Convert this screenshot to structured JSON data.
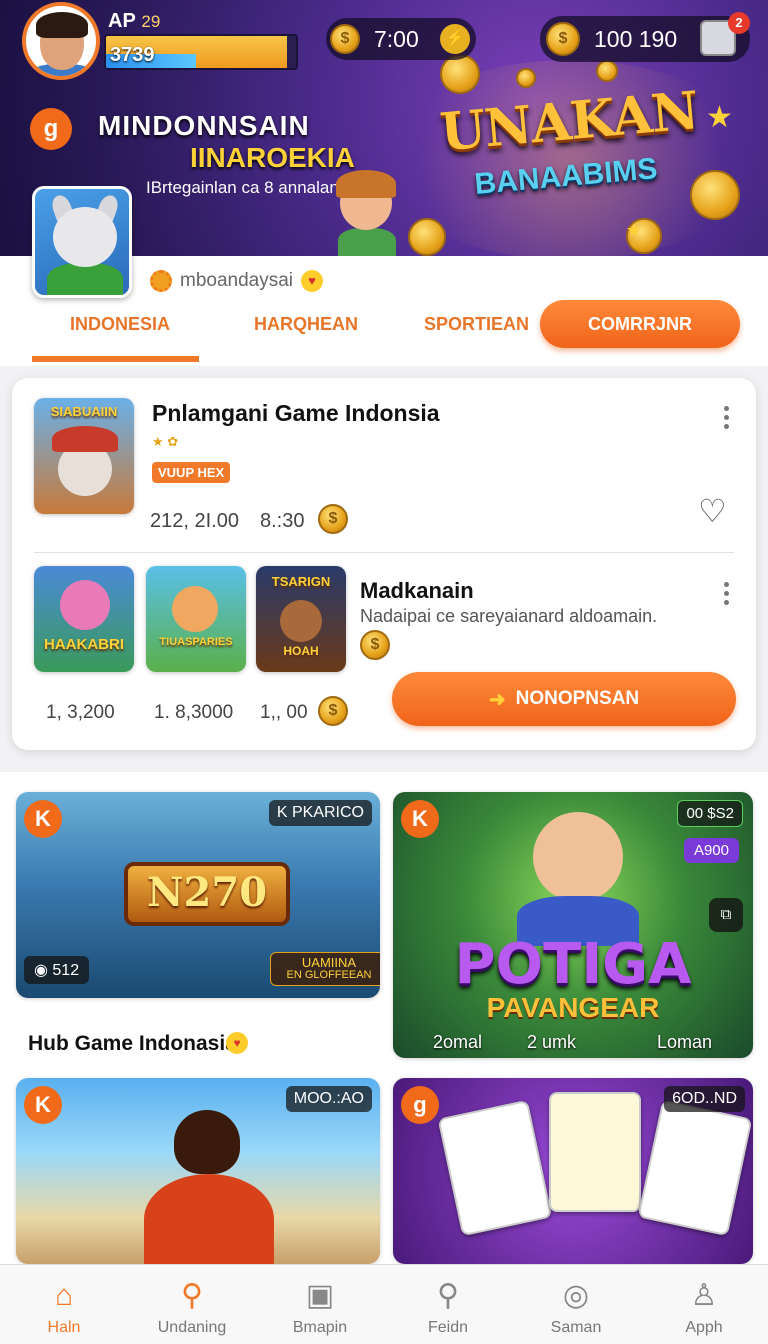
{
  "header": {
    "player_level": "AP",
    "player_level_num": "29",
    "xp_value": "3739",
    "xp_progress": 0.95,
    "timer": "7:00",
    "coin_balance": "100 190",
    "notification_count": "2",
    "brand_logo_letter": "g",
    "brand_title": "MINDONNSAIN",
    "brand_subtitle": "IINAROEKIA",
    "brand_description": "IBrtegainlan ca 8 annalani",
    "promo_title": "UNAKAN",
    "promo_subtitle": "BANAABIMS"
  },
  "profile": {
    "handle": "mboandaysai"
  },
  "tabs": [
    {
      "label": "INDONESIA",
      "active": true
    },
    {
      "label": "HARQHEAN",
      "active": false
    },
    {
      "label": "SPORTIEAN",
      "active": false
    }
  ],
  "community_button": "COMRRJNR",
  "featured": {
    "thumb_label": "SIABUAIIN",
    "title": "Pnlamgani Game Indonsia",
    "tag": "VUUP HEX",
    "stat_players": "212, 2I.00",
    "stat_time": "8.:30",
    "second": {
      "title": "Madkanain",
      "description": "Nadaipai ce sareyaianard aldoamain.",
      "thumbs": [
        "HAAKABRI",
        "TIUASPARIES",
        "TSARIGN"
      ],
      "thumb3_sub": "HOAH",
      "stats": [
        "1, 3,200",
        "1. 8,3000",
        "1,, 00"
      ],
      "play_button": "NONOPNSAN"
    }
  },
  "grid": {
    "tile1": {
      "badge": "K",
      "corner": "K PKARICO",
      "sign": "N270",
      "count": "512",
      "sub_line1": "UAMIINA",
      "sub_line2": "EN GLOFFEEAN"
    },
    "hub_title": "Hub Game Indonasia",
    "tile2": {
      "badge": "K",
      "chip1": "00 $S2",
      "chip2": "A900",
      "big": "POTIGA",
      "big_sub": "PAVANGEAR",
      "stat1": "2omal",
      "stat2": "2 umk",
      "stat3": "Loman"
    },
    "tile3": {
      "badge": "K",
      "corner": "MOO.:AO"
    },
    "tile4": {
      "badge": "g",
      "corner": "6OD..ND"
    }
  },
  "bottom_nav": [
    {
      "label": "Haln",
      "icon": "home-icon",
      "active": true
    },
    {
      "label": "Undaning",
      "icon": "search-icon",
      "active": false
    },
    {
      "label": "Bmapin",
      "icon": "camera-icon",
      "active": false
    },
    {
      "label": "Feidn",
      "icon": "search-icon",
      "active": false
    },
    {
      "label": "Saman",
      "icon": "chat-icon",
      "active": false
    },
    {
      "label": "Apph",
      "icon": "user-icon",
      "active": false
    }
  ],
  "colors": {
    "accent": "#f07a2a",
    "banner_dark": "#2a1a5a",
    "gold": "#ffc03a"
  }
}
